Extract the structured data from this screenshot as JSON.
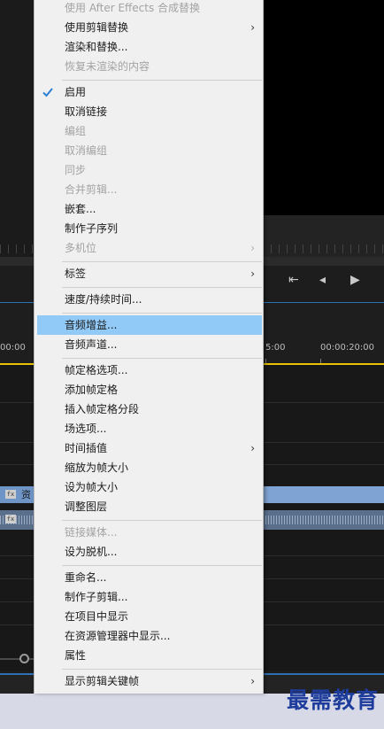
{
  "menu": {
    "items": [
      {
        "label": "使用 After Effects 合成替换",
        "disabled": true,
        "submenu": false
      },
      {
        "label": "使用剪辑替换",
        "disabled": false,
        "submenu": true
      },
      {
        "label": "渲染和替换...",
        "disabled": false,
        "submenu": false
      },
      {
        "label": "恢复未渲染的内容",
        "disabled": true,
        "submenu": false
      },
      {
        "label": "启用",
        "disabled": false,
        "submenu": false,
        "checked": true
      },
      {
        "label": "取消链接",
        "disabled": false,
        "submenu": false
      },
      {
        "label": "编组",
        "disabled": true,
        "submenu": false
      },
      {
        "label": "取消编组",
        "disabled": true,
        "submenu": false
      },
      {
        "label": "同步",
        "disabled": true,
        "submenu": false
      },
      {
        "label": "合并剪辑...",
        "disabled": true,
        "submenu": false
      },
      {
        "label": "嵌套...",
        "disabled": false,
        "submenu": false
      },
      {
        "label": "制作子序列",
        "disabled": false,
        "submenu": false
      },
      {
        "label": "多机位",
        "disabled": true,
        "submenu": true
      },
      {
        "label": "标签",
        "disabled": false,
        "submenu": true
      },
      {
        "label": "速度/持续时间...",
        "disabled": false,
        "submenu": false
      },
      {
        "label": "音频增益...",
        "disabled": false,
        "submenu": false,
        "highlighted": true
      },
      {
        "label": "音频声道...",
        "disabled": false,
        "submenu": false
      },
      {
        "label": "帧定格选项...",
        "disabled": false,
        "submenu": false
      },
      {
        "label": "添加帧定格",
        "disabled": false,
        "submenu": false
      },
      {
        "label": "插入帧定格分段",
        "disabled": false,
        "submenu": false
      },
      {
        "label": "场选项...",
        "disabled": false,
        "submenu": false
      },
      {
        "label": "时间插值",
        "disabled": false,
        "submenu": true
      },
      {
        "label": "缩放为帧大小",
        "disabled": false,
        "submenu": false
      },
      {
        "label": "设为帧大小",
        "disabled": false,
        "submenu": false
      },
      {
        "label": "调整图层",
        "disabled": false,
        "submenu": false
      },
      {
        "label": "链接媒体...",
        "disabled": true,
        "submenu": false
      },
      {
        "label": "设为脱机...",
        "disabled": false,
        "submenu": false
      },
      {
        "label": "重命名...",
        "disabled": false,
        "submenu": false
      },
      {
        "label": "制作子剪辑...",
        "disabled": false,
        "submenu": false
      },
      {
        "label": "在项目中显示",
        "disabled": false,
        "submenu": false
      },
      {
        "label": "在资源管理器中显示...",
        "disabled": false,
        "submenu": false
      },
      {
        "label": "属性",
        "disabled": false,
        "submenu": false
      },
      {
        "label": "显示剪辑关键帧",
        "disabled": false,
        "submenu": true
      }
    ],
    "submenu_glyph": "›",
    "check_icon": "checkmark-icon"
  },
  "timeline": {
    "timecodes": [
      "00:00",
      "5:00",
      "00:00:20:00"
    ],
    "clip_video_label": "资",
    "fx_badge": "fx"
  },
  "transport": {
    "icons": [
      "step-back-icon",
      "frame-back-icon",
      "play-icon"
    ],
    "glyphs": [
      "⇤",
      "◂",
      "▶"
    ]
  },
  "watermark": {
    "text": "最需教育"
  },
  "colors": {
    "highlight": "#91c9f7",
    "menu_bg": "#f0f0f0",
    "playhead": "#e6c200",
    "accent": "#2f6fb3",
    "watermark": "#1d3c9c"
  }
}
